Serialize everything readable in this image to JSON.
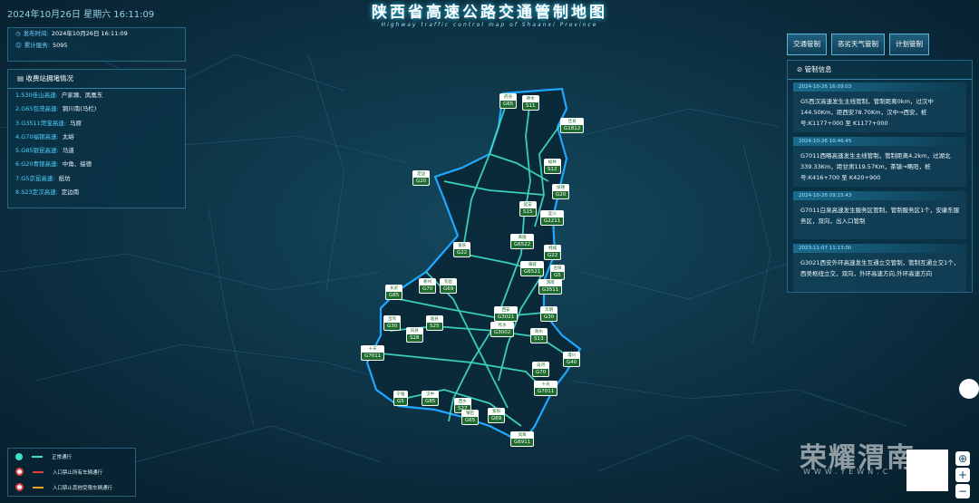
{
  "header": {
    "datetime": "2024年10月26日  星期六  16:11:09",
    "title": "陕西省高速公路交通管制地图",
    "subtitle": "Highway traffic control map of Shaanxi Province"
  },
  "info": {
    "publish_label": "发布时间:",
    "publish_value": "2024年10月26日 16:11:09",
    "total_label": "累计服务:",
    "total_value": "5095"
  },
  "toll": {
    "title": "收费站拥堵情况",
    "items": [
      {
        "route": "1.S30佳山高速:",
        "place": "户家塬、凤凰东"
      },
      {
        "route": "2.G65包茂高速:",
        "place": "铜川南(马栏)"
      },
      {
        "route": "3.G3511菏宝高速:",
        "place": "马原"
      },
      {
        "route": "4.G70福银高速:",
        "place": "太峪"
      },
      {
        "route": "5.G85银昆高速:",
        "place": "马道"
      },
      {
        "route": "6.G20青银高速:",
        "place": "中角、绥德"
      },
      {
        "route": "7.G5京昆高速:",
        "place": "纸坊"
      },
      {
        "route": "8.S23定汉高速:",
        "place": "定边南"
      }
    ]
  },
  "buttons": [
    "交通管制",
    "恶劣天气管制",
    "计划管制"
  ],
  "control": {
    "title": "管制信息",
    "cards": [
      {
        "time": "2024-10-26 16:09:03",
        "text": "G5西汉高速发生主线管制，管制距离0km，过汉中144.50Km，距西安78.70Km，汉中→西安，桩号:K1177+000 至 K1177+000"
      },
      {
        "time": "2024-10-26 10:46:45",
        "text": "G7011西略高速发生主线管制，管制距离4.2km，过湖北339.33Km，距甘肃119.57Km，茶镇→略阳，桩号:K416+700 至 K420+900"
      },
      {
        "time": "2024-10-26 09:15:43",
        "text": "G7011白泉高速发生服务区管制，管制服务区1个，安康东服务区，双向，出入口管制"
      },
      {
        "time": "2023-11-07 11:13:00",
        "text": "G3021西安外环高速发生互通立交管制，管制互通立交1个，西吴枢纽立交，双向，外环高速方向,外环高速方向"
      }
    ]
  },
  "legend": [
    {
      "label": "正常通行",
      "color": "#41e0c8"
    },
    {
      "label": "入口禁止所有车辆通行",
      "color": "#e23d3d"
    },
    {
      "label": "入口禁止其他受限车辆通行",
      "color": "#f0a020"
    }
  ],
  "watermark": {
    "brand": "荣耀渭南",
    "url": "WWW.YEWN.C"
  },
  "signs": [
    {
      "name": "府谷",
      "code": "G65"
    },
    {
      "name": "神木",
      "code": "S11"
    },
    {
      "name": "佳县",
      "code": "G1812"
    },
    {
      "name": "榆林",
      "code": "S12"
    },
    {
      "name": "定边",
      "code": "G20"
    },
    {
      "name": "绥德",
      "code": "G20"
    },
    {
      "name": "延安",
      "code": "S15"
    },
    {
      "name": "宜川",
      "code": "G2211"
    },
    {
      "name": "富县",
      "code": "G22"
    },
    {
      "name": "黄陵",
      "code": "G6522"
    },
    {
      "name": "韩城",
      "code": "G22"
    },
    {
      "name": "蒲城",
      "code": "G6521"
    },
    {
      "name": "合阳",
      "code": "G5"
    },
    {
      "name": "长武",
      "code": "G85"
    },
    {
      "name": "彬州",
      "code": "G70"
    },
    {
      "name": "旬邑",
      "code": "G69"
    },
    {
      "name": "渭南",
      "code": "G3511"
    },
    {
      "name": "西安",
      "code": "G3021"
    },
    {
      "name": "华阴",
      "code": "G30"
    },
    {
      "name": "宝鸡",
      "code": "G30"
    },
    {
      "name": "凤县",
      "code": "S28"
    },
    {
      "name": "眉县",
      "code": "S25"
    },
    {
      "name": "柞水",
      "code": "G3002"
    },
    {
      "name": "商州",
      "code": "S13"
    },
    {
      "name": "十天",
      "code": "G7011"
    },
    {
      "name": "漫川",
      "code": "G40"
    },
    {
      "name": "白河",
      "code": "G70"
    },
    {
      "name": "十天",
      "code": "G7011"
    },
    {
      "name": "宁强",
      "code": "G5"
    },
    {
      "name": "汉中",
      "code": "G85"
    },
    {
      "name": "西乡",
      "code": "S27"
    },
    {
      "name": "镇巴",
      "code": "G65"
    },
    {
      "name": "紫阳",
      "code": "G69"
    },
    {
      "name": "岚皋",
      "code": "G6911"
    }
  ]
}
